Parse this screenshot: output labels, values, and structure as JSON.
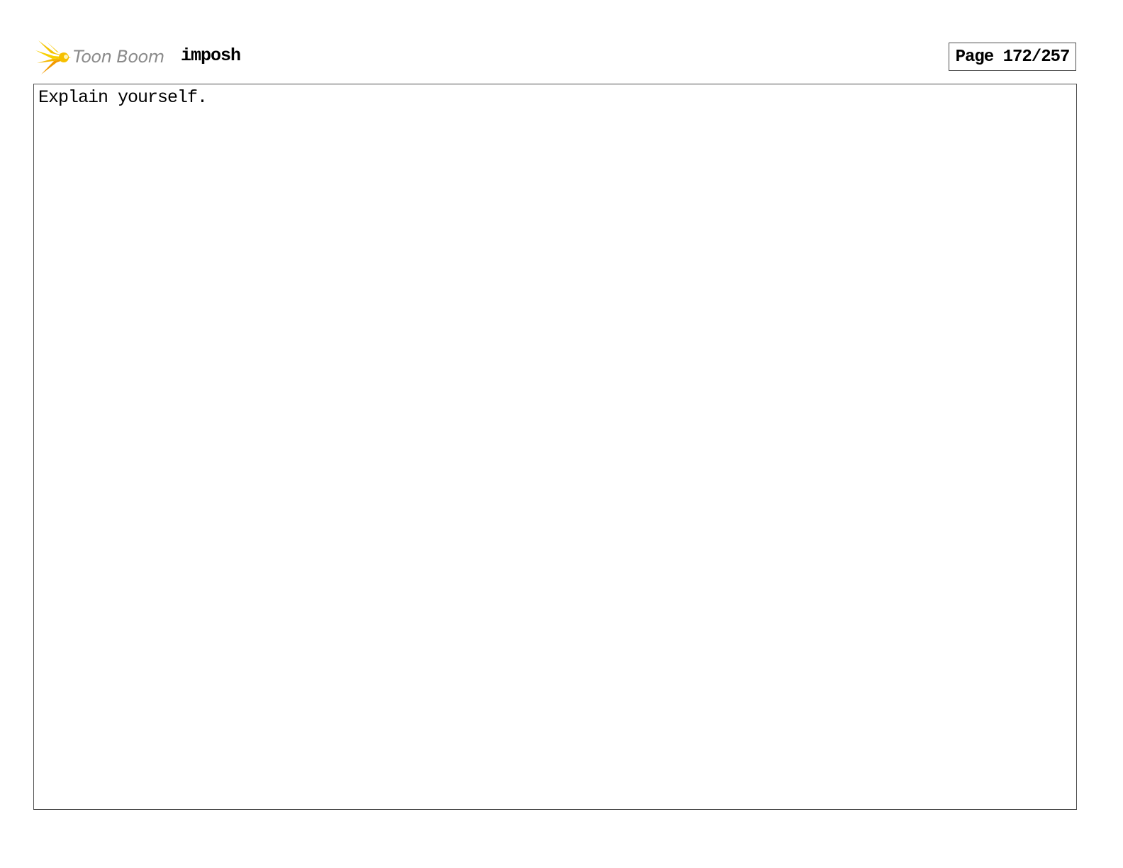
{
  "header": {
    "brand": "Toon Boom",
    "project": "imposh",
    "page_label": "Page 172/257"
  },
  "panel": {
    "text": "Explain yourself."
  },
  "colors": {
    "logo_yellow": "#f5c400",
    "logo_orange": "#f39a00",
    "brand_gray": "#8a8a8a",
    "border": "#4d4d4d"
  }
}
